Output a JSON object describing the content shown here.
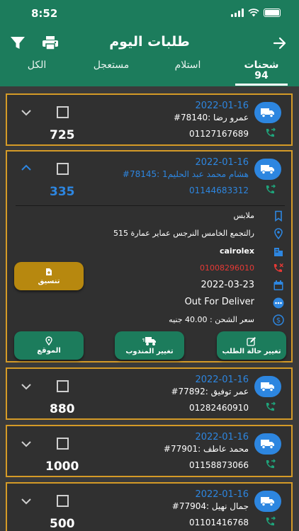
{
  "status": {
    "time": "8:52"
  },
  "header": {
    "title": "طلبات اليوم"
  },
  "tabs": [
    {
      "label": "شحنات",
      "count": "94"
    },
    {
      "label": "استلام"
    },
    {
      "label": "مستعجل"
    },
    {
      "label": "الكل"
    }
  ],
  "orders": [
    {
      "date": "2022-01-16",
      "order": "#78140: عمرو رضا",
      "phone": "01127167689",
      "amount": "725"
    },
    {
      "date": "2022-01-16",
      "order": "#78145: هشام محمد عبد الحليم1",
      "phone": "01144683312",
      "amount": "335",
      "details": {
        "item": "ملابس",
        "address": "رالتجمع الخامس النرجس عماير عمارة 515",
        "company": "cairolex",
        "alt_phone": "01008296010",
        "due_date": "2022-03-23",
        "status": "Out For Deliver",
        "shipping": "سعر الشحن : 40.00 جنيه"
      },
      "buttons": {
        "coordinate": "تنسيق",
        "change_status": "تغيير حالة الطلب",
        "change_courier": "تغيير المندوب",
        "location": "الموقع"
      }
    },
    {
      "date": "2022-01-16",
      "order": "#77892: عمر توفيق",
      "phone": "01282460910",
      "amount": "880"
    },
    {
      "date": "2022-01-16",
      "order": "#77901: محمد عاطف",
      "phone": "01158873066",
      "amount": "1000"
    },
    {
      "date": "2022-01-16",
      "order": "#77904: جمال نهيل",
      "phone": "01101416768",
      "amount": "500"
    }
  ],
  "colors": {
    "header": "#1c7c5c",
    "accent": "#2d86e0",
    "border": "#d49a27",
    "danger": "#e53935"
  }
}
